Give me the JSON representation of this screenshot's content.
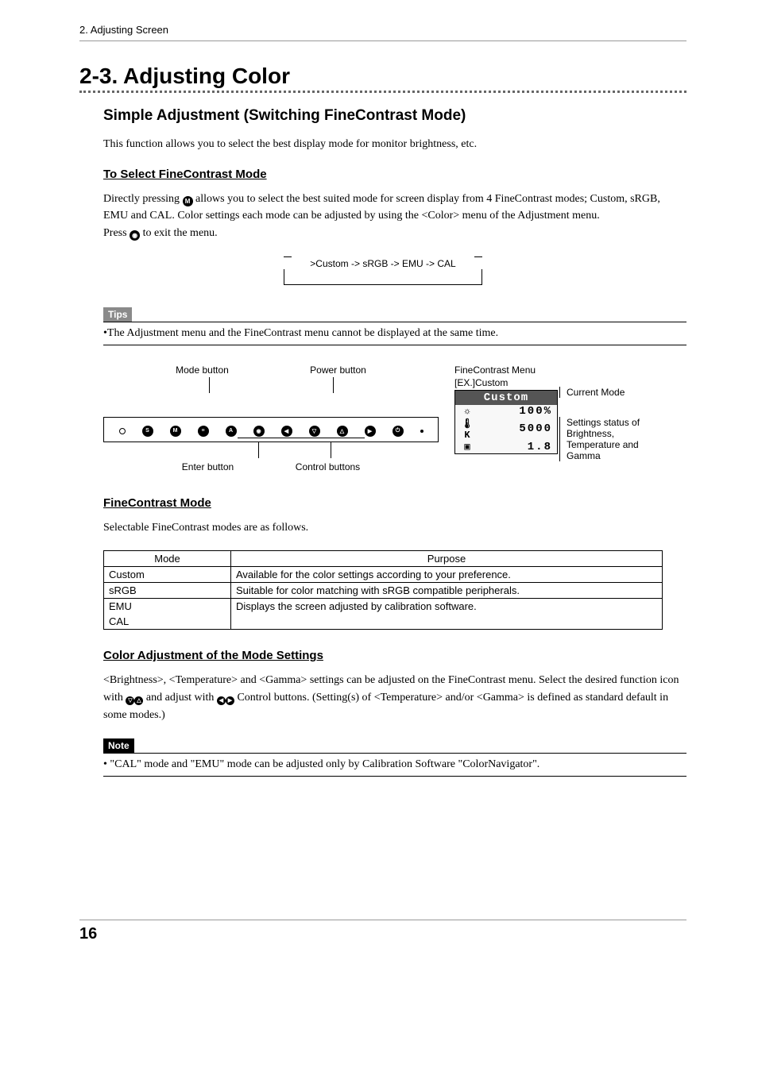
{
  "header": {
    "breadcrumb": "2. Adjusting Screen"
  },
  "section": {
    "title": "2-3. Adjusting Color",
    "sub1": {
      "title": "Simple Adjustment (Switching FineContrast Mode)",
      "intro": "This function allows you to select the best display mode for monitor brightness, etc.",
      "h1": "To Select FineContrast Mode",
      "p1a": "Directly pressing ",
      "p1b": " allows you to select the best suited mode for screen display from 4 FineContrast modes; Custom, sRGB, EMU and CAL. Color settings each mode can be adjusted by using the <Color> menu of the Adjustment menu.",
      "p1c": "Press ",
      "p1d": " to exit the menu.",
      "cycle": ">Custom -> sRGB -> EMU -> CAL",
      "tips_label": "Tips",
      "tips_body": "•The Adjustment menu and the FineContrast menu cannot be displayed at the same time.",
      "diagram": {
        "mode_btn": "Mode button",
        "power_btn": "Power button",
        "enter_btn": "Enter button",
        "ctrl_btns": "Control buttons",
        "fc_title_a": "FineContrast Menu",
        "fc_title_b": "[EX.]Custom",
        "fc_bar": "Custom",
        "fc_brightness": "100%",
        "fc_temp": "5000",
        "fc_gamma": "1.8",
        "r_curmode": "Current Mode",
        "r_status": "Settings status of Brightness, Temperature and Gamma"
      },
      "h2": "FineContrast Mode",
      "p2": "Selectable FineContrast modes are as follows.",
      "table": {
        "col_mode": "Mode",
        "col_purpose": "Purpose",
        "rows": [
          {
            "mode": "Custom",
            "purpose": "Available for the color settings according to your preference."
          },
          {
            "mode": "sRGB",
            "purpose": "Suitable for color matching with sRGB compatible peripherals."
          },
          {
            "mode": "EMU",
            "purpose": "Displays the screen adjusted by calibration software."
          },
          {
            "mode": "CAL",
            "purpose": ""
          }
        ]
      },
      "h3": "Color Adjustment of the Mode Settings",
      "p3a": "<Brightness>, <Temperature> and <Gamma> settings can be adjusted on the FineContrast menu. Select the desired function icon with ",
      "p3b": " and adjust with ",
      "p3c": " Control buttons. (Setting(s) of <Temperature> and/or <Gamma> is defined as standard default in some modes.)",
      "note_label": "Note",
      "note_body": "•  \"CAL\" mode and \"EMU\" mode can be adjusted only by Calibration Software \"ColorNavigator\"."
    }
  },
  "page_number": "16"
}
